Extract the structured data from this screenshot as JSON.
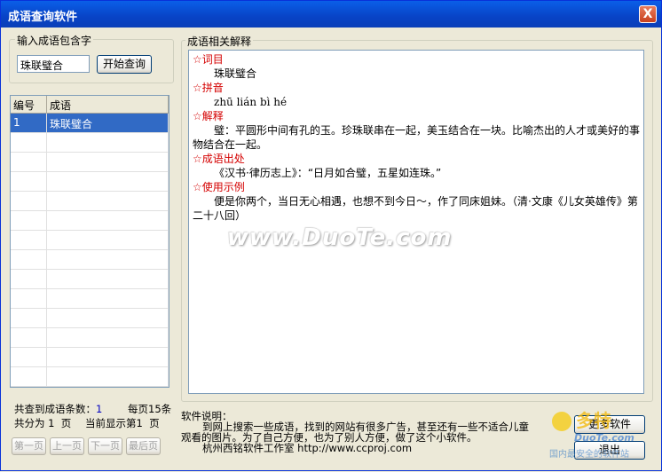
{
  "window": {
    "title": "成语查询软件",
    "close": "X"
  },
  "search": {
    "group_label": "输入成语包含字",
    "value": "珠联璧合",
    "button": "开始查询"
  },
  "list": {
    "col_num": "编号",
    "col_idiom": "成语",
    "rows": [
      {
        "num": "1",
        "idiom": "珠联璧合"
      }
    ]
  },
  "detail": {
    "group_label": "成语相关解释",
    "h_word": "☆词目",
    "word": "珠联璧合",
    "h_pinyin": "☆拼音",
    "pinyin": "zhū  lián  bì  hé",
    "h_meaning": "☆解释",
    "meaning": "璧：平圆形中间有孔的玉。珍珠联串在一起，美玉结合在一块。比喻杰出的人才或美好的事物结合在一起。",
    "h_source": "☆成语出处",
    "source": "《汉书·律历志上》：“日月如合璧，五星如连珠。”",
    "h_example": "☆使用示例",
    "example": "便是你两个，当日无心相遇，也想不到今日～，作了同床姐妹。（清·文康《儿女英雄传》第二十八回）"
  },
  "stats": {
    "found_label": "共查到成语条数：",
    "found": "1",
    "per_page_label": "每页",
    "per_page": "15",
    "per_page_unit": "条",
    "pages_label": "共分为",
    "pages": "1",
    "pages_unit": "页",
    "current_label": "当前显示第",
    "current": "1",
    "current_unit": "页"
  },
  "pager": {
    "first": "第一页",
    "prev": "上一页",
    "next": "下一页",
    "last": "最后页"
  },
  "info": {
    "title": "软件说明：",
    "line1": "到网上搜索一些成语，找到的网站有很多广告，甚至还有一些不适合儿童",
    "line2": "观看的图片。为了自己方便，也为了别人方便，做了这个小软件。",
    "line3": "杭州西铭软件工作室 http://www.ccproj.com"
  },
  "actions": {
    "more": "更多软件",
    "exit": "退出"
  },
  "watermark": "www.DuoTe.com",
  "corner_logo": {
    "brand": "多特",
    "text1": "DuoTe.com",
    "text2": "国内最安全的软件站"
  }
}
